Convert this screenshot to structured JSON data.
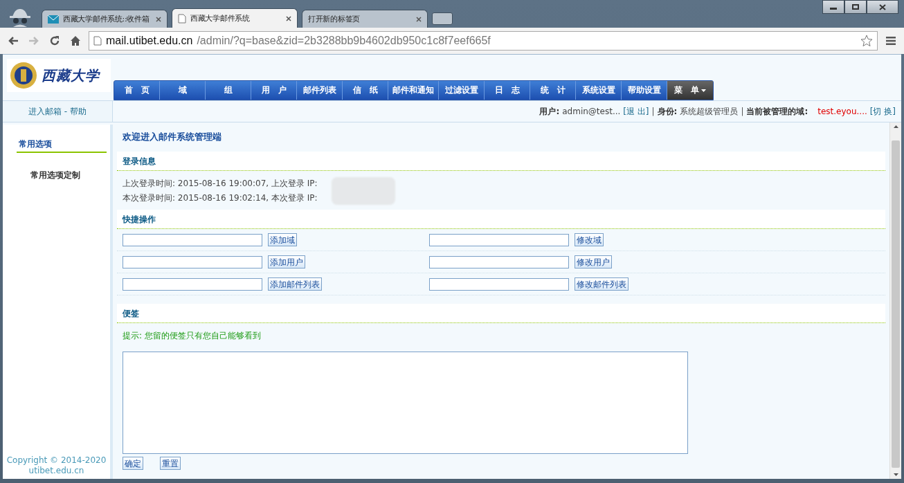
{
  "browser": {
    "tabs": [
      {
        "title": "西藏大学邮件系统::收件箱",
        "kind": "mail",
        "selected": false
      },
      {
        "title": "西藏大学邮件系统",
        "kind": "page",
        "selected": true
      },
      {
        "title": "打开新的标签页",
        "kind": "none",
        "selected": false
      }
    ],
    "url_host": "mail.utibet.edu.cn",
    "url_path": "/admin/?q=base&zid=2b3288bb9b4602db950c1c8f7eef665f"
  },
  "logo": {
    "text": "西藏大学"
  },
  "nav": [
    {
      "label": "首　页",
      "kind": "link"
    },
    {
      "label": "域",
      "kind": "link"
    },
    {
      "label": "组",
      "kind": "link"
    },
    {
      "label": "用　户",
      "kind": "link"
    },
    {
      "label": "邮件列表",
      "kind": "link"
    },
    {
      "label": "信　纸",
      "kind": "link"
    },
    {
      "label": "邮件和通知",
      "kind": "link"
    },
    {
      "label": "过滤设置",
      "kind": "link"
    },
    {
      "label": "日　志",
      "kind": "link"
    },
    {
      "label": "统　计",
      "kind": "link"
    },
    {
      "label": "系统设置",
      "kind": "link"
    },
    {
      "label": "帮助设置",
      "kind": "link"
    },
    {
      "label": "菜　单",
      "kind": "menu"
    }
  ],
  "top_links": "进入邮箱 - 帮助",
  "user_bar": [
    {
      "text": "用户:",
      "kind": "label"
    },
    {
      "text": "admin@test...",
      "kind": "value"
    },
    {
      "text": "[退 出]",
      "kind": "link"
    },
    {
      "text": "|",
      "kind": "sep"
    },
    {
      "text": "身份:",
      "kind": "label"
    },
    {
      "text": "系统超级管理员",
      "kind": "value"
    },
    {
      "text": "|",
      "kind": "sep"
    },
    {
      "text": "当前被管理的域:",
      "kind": "label"
    },
    {
      "text": "test.eyou....",
      "kind": "domain"
    },
    {
      "text": "[切 换]",
      "kind": "link"
    }
  ],
  "sidebar": {
    "items": [
      {
        "label": "常用选项",
        "selected": true
      },
      {
        "label": "常用选项定制",
        "selected": false
      }
    ],
    "copyright": "Copyright © 2014-2020",
    "site": "utibet.edu.cn"
  },
  "content": {
    "title": "欢迎进入邮件系统管理端",
    "login_info": {
      "heading": "登录信息",
      "lines": [
        "上次登录时间: 2015-08-16 19:00:07, 上次登录 IP:",
        "本次登录时间: 2015-08-16 19:02:14, 本次登录 IP:"
      ]
    },
    "quick": {
      "heading": "快捷操作",
      "rows": [
        [
          "添加域",
          "修改域"
        ],
        [
          "添加用户",
          "修改用户"
        ],
        [
          "添加邮件列表",
          "修改邮件列表"
        ]
      ]
    },
    "note": {
      "heading": "便签",
      "hint": "提示: 您留的便签只有您自己能够看到",
      "buttons": [
        "确定",
        "重置"
      ]
    }
  }
}
